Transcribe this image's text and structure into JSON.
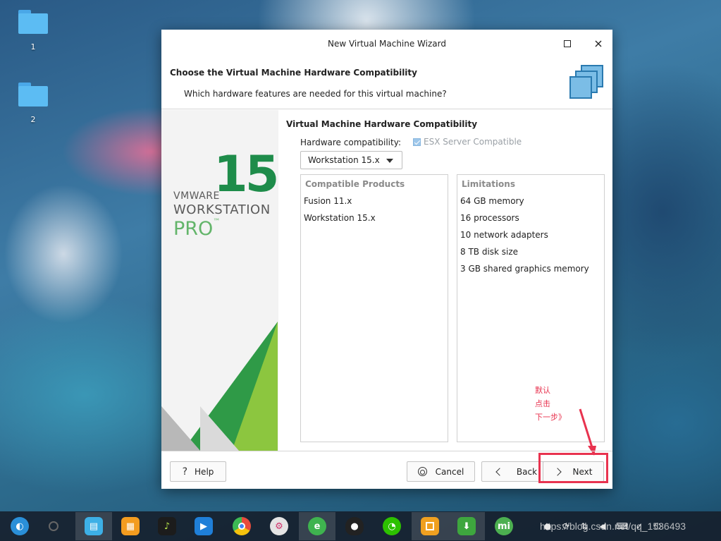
{
  "desktop": {
    "icons": [
      {
        "label": "1",
        "icon": "folder-icon"
      },
      {
        "label": "2",
        "icon": "folder-icon"
      }
    ]
  },
  "dialog": {
    "title": "New Virtual Machine Wizard",
    "header": {
      "title": "Choose the Virtual Machine Hardware Compatibility",
      "subtitle": "Which hardware features are needed for this virtual machine?"
    },
    "branding": {
      "version": "15",
      "vendor": "VMWARE",
      "product": "WORKSTATION",
      "edition": "PRO",
      "trademark": "™",
      "accent_color": "#1e8c4a"
    },
    "section_title": "Virtual Machine Hardware Compatibility",
    "hardware_compatibility_label": "Hardware compatibility:",
    "hardware_compatibility_value": "Workstation 15.x",
    "esx_label": "ESX Server Compatible",
    "compatible_products": {
      "header": "Compatible Products",
      "items": [
        "Fusion 11.x",
        "Workstation 15.x"
      ]
    },
    "limitations": {
      "header": "Limitations",
      "items": [
        "64 GB memory",
        "16 processors",
        "10 network adapters",
        "8 TB disk size",
        "3 GB shared graphics memory"
      ]
    },
    "annotation": [
      "默认",
      "点击",
      "下一步》"
    ],
    "buttons": {
      "help": "Help",
      "cancel": "Cancel",
      "back": "Back",
      "next": "Next"
    }
  },
  "taskbar": {
    "apps": [
      {
        "name": "launcher",
        "color": "#2a8fd8"
      },
      {
        "name": "multitasking",
        "color": "#3a3f48"
      },
      {
        "name": "file-manager",
        "color": "#3db0e6"
      },
      {
        "name": "app-store",
        "color": "#f39c1f"
      },
      {
        "name": "music",
        "color": "#1c1c1c"
      },
      {
        "name": "video",
        "color": "#1f7fd8"
      },
      {
        "name": "chrome",
        "color": "#e74c3c"
      },
      {
        "name": "settings",
        "color": "#e4e4e4"
      },
      {
        "name": "browser",
        "color": "#3fb34f"
      },
      {
        "name": "qq",
        "color": "#222222"
      },
      {
        "name": "wechat",
        "color": "#2dc100"
      },
      {
        "name": "vmware",
        "color": "#f0a020"
      },
      {
        "name": "store",
        "color": "#3ea63e"
      },
      {
        "name": "mi",
        "color": "#4caf50"
      }
    ],
    "watermark": "https://blog.csdn.net/qq_1536493"
  }
}
